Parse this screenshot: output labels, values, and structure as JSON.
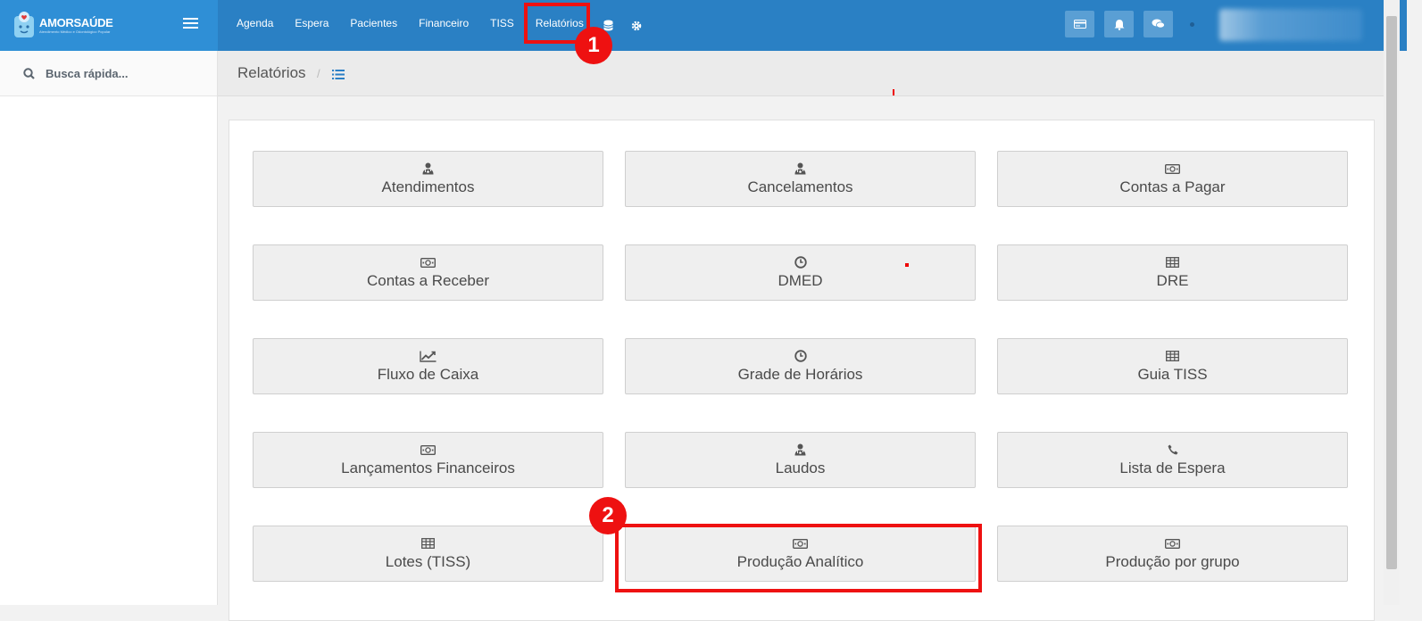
{
  "brand": {
    "name": "AMORSAÚDE",
    "sub": "Atendimento Médico e Odontológico Popular"
  },
  "nav": {
    "items": [
      "Agenda",
      "Espera",
      "Pacientes",
      "Financeiro",
      "TISS",
      "Relatórios"
    ],
    "icons": [
      "database-icon",
      "gear-icon"
    ]
  },
  "tools": [
    "card-icon",
    "bell-icon",
    "chat-icon"
  ],
  "sidebar": {
    "search_placeholder": "Busca rápida..."
  },
  "breadcrumb": {
    "title": "Relatórios",
    "separator": "/"
  },
  "reports": [
    {
      "label": "Atendimentos",
      "icon": "user-doctor-icon"
    },
    {
      "label": "Cancelamentos",
      "icon": "user-doctor-icon"
    },
    {
      "label": "Contas a Pagar",
      "icon": "money-icon"
    },
    {
      "label": "Contas a Receber",
      "icon": "money-icon"
    },
    {
      "label": "DMED",
      "icon": "clock-icon"
    },
    {
      "label": "DRE",
      "icon": "table-icon"
    },
    {
      "label": "Fluxo de Caixa",
      "icon": "chart-line-icon"
    },
    {
      "label": "Grade de Horários",
      "icon": "clock-icon"
    },
    {
      "label": "Guia TISS",
      "icon": "table-icon"
    },
    {
      "label": "Lançamentos Financeiros",
      "icon": "money-icon"
    },
    {
      "label": "Laudos",
      "icon": "user-doctor-icon"
    },
    {
      "label": "Lista de Espera",
      "icon": "phone-icon"
    },
    {
      "label": "Lotes (TISS)",
      "icon": "table-icon"
    },
    {
      "label": "Produção Analítico",
      "icon": "money-icon"
    },
    {
      "label": "Produção por grupo",
      "icon": "money-icon"
    }
  ],
  "annotations": {
    "step1": "1",
    "step2": "2"
  },
  "colors": {
    "header": "#2a80c4",
    "logo_bg": "#2f8fd6",
    "highlight": "#ee1111"
  }
}
